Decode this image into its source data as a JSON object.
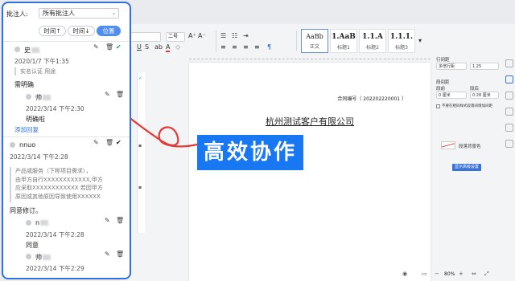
{
  "review": {
    "filter_label": "批注人:",
    "filter_value": "所有批注人",
    "sort_buttons": [
      "时间↑",
      "时间↓",
      "位置"
    ],
    "threads": [
      {
        "author": "史",
        "time": "2020/1/7 下午1:35",
        "quote": "实名认证 用途",
        "body": "需明确",
        "replies": [
          {
            "author": "帅",
            "time": "2022/3/14 下午2:30",
            "body": "明确啦"
          }
        ],
        "add_reply": "添加回复"
      },
      {
        "author": "nnuo",
        "time": "2022/3/14 下午2:28",
        "quote": "产品或服务（下称项目需求），由甲方自行XXXXXXXXXXXX,甲方应采取XXXXXXXXXXXX 若因甲方原因或其他原因导致使用XXXXXX",
        "quote_lines": [
          "产品或服务（下称项目需求），",
          "由甲方自行XXXXXXXXXXXX,甲方",
          "应采取XXXXXXXXXXXX 若因甲方",
          "原因或其他原因导致使用XXXXXX"
        ],
        "body": "同意修订。",
        "replies": [
          {
            "author": "n",
            "time": "2022/3/14 下午2:28",
            "body": "同意"
          },
          {
            "author": "帅",
            "time": "2022/3/14 下午2:29",
            "body": ""
          }
        ]
      }
    ]
  },
  "document": {
    "contract_no": "合同编号（ 202202220001 ）",
    "company": "杭州测试客户有限公司"
  },
  "ribbon": {
    "font_size": "二号",
    "styles": [
      {
        "sample": "AaBb",
        "name": "正文"
      },
      {
        "sample": "1.AaB",
        "name": "标题1"
      },
      {
        "sample": "1.1.A",
        "name": "标题2"
      },
      {
        "sample": "1.1.1.",
        "name": "标题3"
      }
    ]
  },
  "panel": {
    "line_spacing_label": "行间距",
    "line_spacing_mode": "多倍行距",
    "line_spacing_value": "1.25",
    "para_spacing_label": "段间距",
    "before_label": "段前",
    "after_label": "段后",
    "before_value": "0 厘米",
    "after_value": "0.28 厘米",
    "grid_check": "不要在相同样式段落间增加间距",
    "para_bg_label": "段落背景色",
    "advanced_button": "显示高级设置"
  },
  "status": {
    "zoom": "80%"
  },
  "banner": {
    "text": "高效协作"
  },
  "colors": {
    "accent": "#1877f2",
    "panel_border": "#2f6fde",
    "arrow": "#e53935",
    "check": "#1aa260"
  },
  "icons": [
    "edit-icon",
    "trash-icon",
    "check-icon",
    "chevron-down-icon"
  ]
}
